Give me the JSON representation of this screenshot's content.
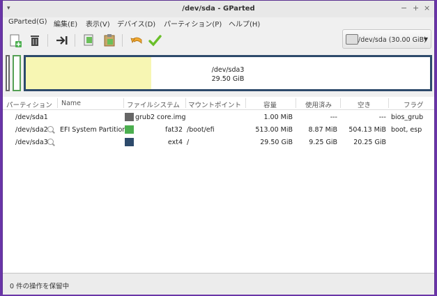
{
  "window": {
    "title": "/dev/sda - GParted",
    "minimize": "−",
    "maximize": "+",
    "close": "×"
  },
  "menu": [
    "GParted(G)",
    "編集(E)",
    "表示(V)",
    "デバイス(D)",
    "パーティション(P)",
    "ヘルプ(H)"
  ],
  "device": {
    "label": "/dev/sda (30.00 GiB)"
  },
  "diskmap": {
    "name": "/dev/sda3",
    "size": "29.50 GiB"
  },
  "columns": [
    "パーティション",
    "Name",
    "ファイルシステム",
    "マウントポイント",
    "容量",
    "使用済み",
    "空き",
    "フラグ"
  ],
  "rows": [
    {
      "partition": "/dev/sda1",
      "name": "",
      "filesystem": "grub2 core.img",
      "mount": "",
      "size": "1.00 MiB",
      "used": "---",
      "free": "---",
      "flags": "bios_grub",
      "color": "#666666"
    },
    {
      "partition": "/dev/sda2",
      "name": "EFI System Partition",
      "filesystem": "fat32",
      "mount": "/boot/efi",
      "size": "513.00 MiB",
      "used": "8.87 MiB",
      "free": "504.13 MiB",
      "flags": "boot, esp",
      "color": "#4caf50"
    },
    {
      "partition": "/dev/sda3",
      "name": "",
      "filesystem": "ext4",
      "mount": "/",
      "size": "29.50 GiB",
      "used": "9.25 GiB",
      "free": "20.25 GiB",
      "flags": "",
      "color": "#2d4a6b"
    }
  ],
  "status": "0 件の操作を保留中"
}
